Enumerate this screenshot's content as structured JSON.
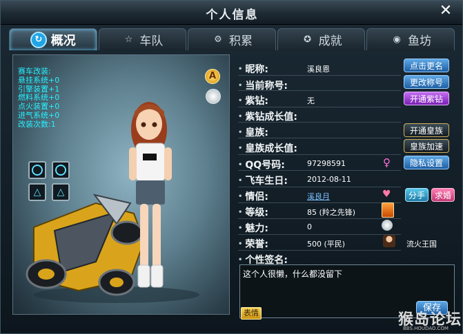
{
  "window": {
    "title": "个人信息",
    "close_label": "✕"
  },
  "tabs": [
    {
      "label": "概况",
      "icon": "refresh-icon",
      "active": true
    },
    {
      "label": "车队",
      "icon": "star-icon",
      "active": false
    },
    {
      "label": "积累",
      "icon": "gear-icon",
      "active": false
    },
    {
      "label": "成就",
      "icon": "medal-icon",
      "active": false
    },
    {
      "label": "鱼坊",
      "icon": "fish-icon",
      "active": false
    }
  ],
  "modifications": {
    "lines": [
      "赛车改装:",
      "悬挂系统+0",
      "引擎装置+1",
      "燃料系统+0",
      "点火装置+0",
      "进气系统+0",
      "改装次数:1"
    ]
  },
  "profile": {
    "nickname_label": "昵称:",
    "nickname": "溪良恩",
    "rename_button": "点击更名",
    "title_label": "当前称号:",
    "change_title_button": "更改称号",
    "purple_label": "紫钻:",
    "purple_value": "无",
    "purple_button": "开通紫钻",
    "purple_growth_label": "紫钻成长值:",
    "clan_label": "皇族:",
    "clan_button": "开通皇族",
    "clan_growth_label": "皇族成长值:",
    "clan_speed_button": "皇族加速",
    "qq_label": "QQ号码:",
    "qq_value": "97298591",
    "privacy_button": "隐私设置",
    "birthday_label": "飞车生日:",
    "birthday_value": "2012-08-11",
    "partner_label": "情侣:",
    "partner_value": "溪良月",
    "breakup_button": "分手",
    "marry_button": "求婚",
    "level_label": "等级:",
    "level_value": "85 (羚之先锋)",
    "charm_label": "魅力:",
    "charm_value": "0",
    "honor_label": "荣誉:",
    "honor_value": "500 (平民)",
    "kingdom_value": "流火王国",
    "signature_label": "个性签名:",
    "signature_text": "这个人很懒，什么都没留下",
    "emote_button": "表情",
    "save_button": "保存"
  },
  "watermark": {
    "text": "猴岛论坛",
    "url": "BBS.HOUDAO.COM"
  },
  "colors": {
    "accent": "#27f0ff",
    "link": "#7cc0ff",
    "purple": "#8a2be2"
  }
}
